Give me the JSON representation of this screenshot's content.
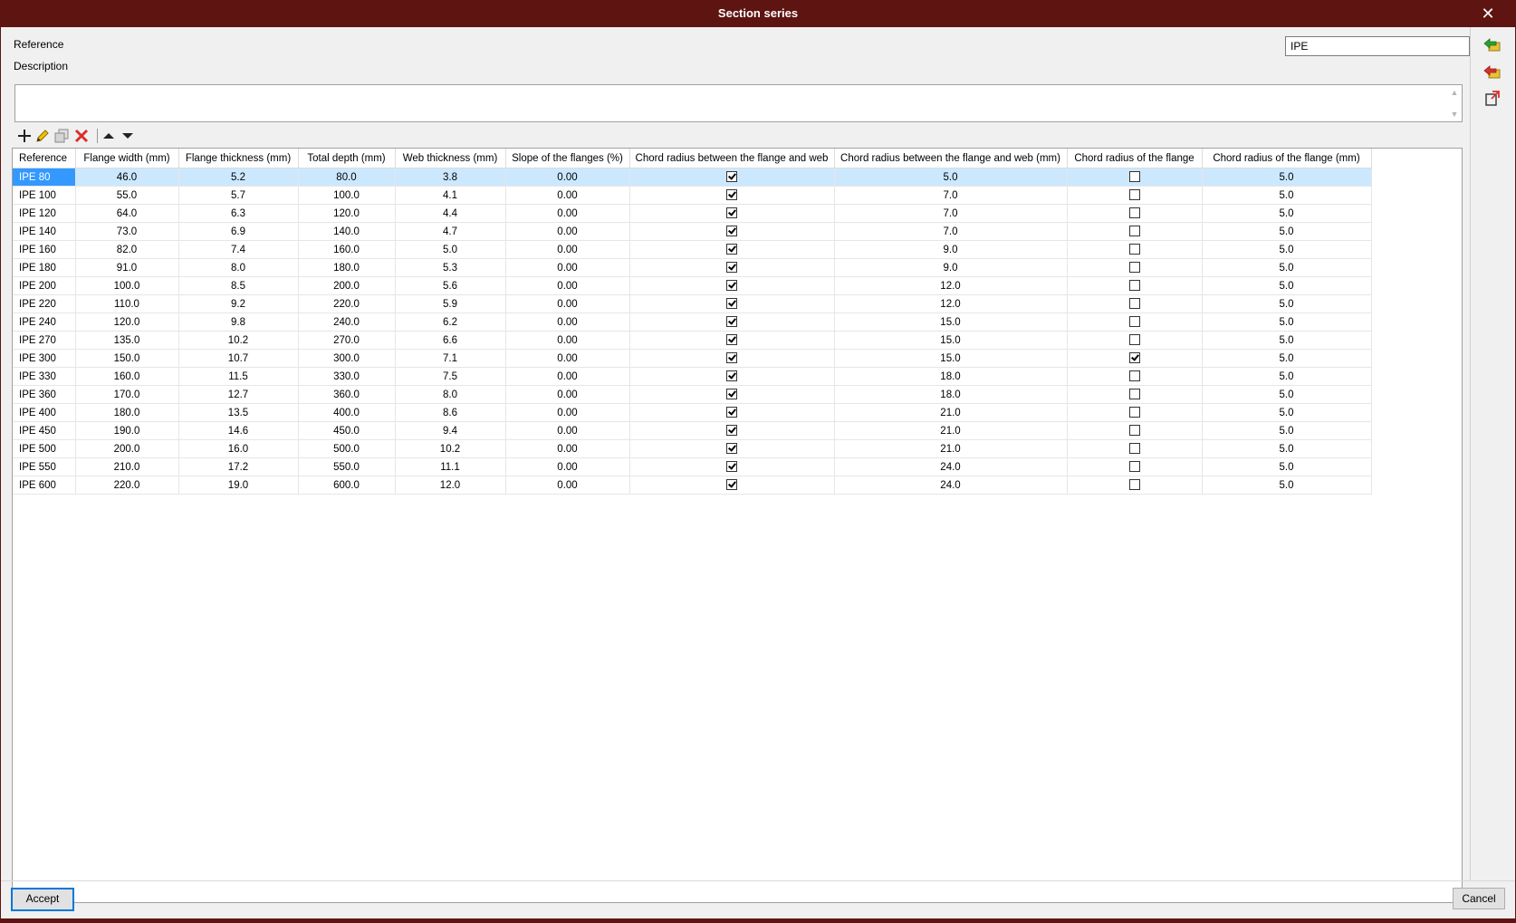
{
  "window": {
    "title": "Section series",
    "close_icon": "close-icon"
  },
  "form": {
    "reference_label": "Reference",
    "reference_value": "IPE",
    "description_label": "Description",
    "description_value": ""
  },
  "toolbar": {
    "icons": [
      "add-icon",
      "edit-pencil-icon",
      "copy-icon",
      "delete-icon",
      "move-up-icon",
      "move-down-icon"
    ]
  },
  "sidebar": {
    "icons": [
      "import-arrow-icon",
      "export-arrow-icon",
      "open-external-icon"
    ]
  },
  "table": {
    "columns": [
      "Reference",
      "Flange width (mm)",
      "Flange thickness (mm)",
      "Total depth (mm)",
      "Web thickness (mm)",
      "Slope of the flanges (%)",
      "Chord radius between the flange and web",
      "Chord radius between the flange and web (mm)",
      "Chord radius of the flange",
      "Chord radius of the flange (mm)"
    ],
    "selected_row": 0,
    "rows": [
      [
        "IPE 80",
        "46.0",
        "5.2",
        "80.0",
        "3.8",
        "0.00",
        true,
        "5.0",
        false,
        "5.0"
      ],
      [
        "IPE 100",
        "55.0",
        "5.7",
        "100.0",
        "4.1",
        "0.00",
        true,
        "7.0",
        false,
        "5.0"
      ],
      [
        "IPE 120",
        "64.0",
        "6.3",
        "120.0",
        "4.4",
        "0.00",
        true,
        "7.0",
        false,
        "5.0"
      ],
      [
        "IPE 140",
        "73.0",
        "6.9",
        "140.0",
        "4.7",
        "0.00",
        true,
        "7.0",
        false,
        "5.0"
      ],
      [
        "IPE 160",
        "82.0",
        "7.4",
        "160.0",
        "5.0",
        "0.00",
        true,
        "9.0",
        false,
        "5.0"
      ],
      [
        "IPE 180",
        "91.0",
        "8.0",
        "180.0",
        "5.3",
        "0.00",
        true,
        "9.0",
        false,
        "5.0"
      ],
      [
        "IPE 200",
        "100.0",
        "8.5",
        "200.0",
        "5.6",
        "0.00",
        true,
        "12.0",
        false,
        "5.0"
      ],
      [
        "IPE 220",
        "110.0",
        "9.2",
        "220.0",
        "5.9",
        "0.00",
        true,
        "12.0",
        false,
        "5.0"
      ],
      [
        "IPE 240",
        "120.0",
        "9.8",
        "240.0",
        "6.2",
        "0.00",
        true,
        "15.0",
        false,
        "5.0"
      ],
      [
        "IPE 270",
        "135.0",
        "10.2",
        "270.0",
        "6.6",
        "0.00",
        true,
        "15.0",
        false,
        "5.0"
      ],
      [
        "IPE 300",
        "150.0",
        "10.7",
        "300.0",
        "7.1",
        "0.00",
        true,
        "15.0",
        true,
        "5.0"
      ],
      [
        "IPE 330",
        "160.0",
        "11.5",
        "330.0",
        "7.5",
        "0.00",
        true,
        "18.0",
        false,
        "5.0"
      ],
      [
        "IPE 360",
        "170.0",
        "12.7",
        "360.0",
        "8.0",
        "0.00",
        true,
        "18.0",
        false,
        "5.0"
      ],
      [
        "IPE 400",
        "180.0",
        "13.5",
        "400.0",
        "8.6",
        "0.00",
        true,
        "21.0",
        false,
        "5.0"
      ],
      [
        "IPE 450",
        "190.0",
        "14.6",
        "450.0",
        "9.4",
        "0.00",
        true,
        "21.0",
        false,
        "5.0"
      ],
      [
        "IPE 500",
        "200.0",
        "16.0",
        "500.0",
        "10.2",
        "0.00",
        true,
        "21.0",
        false,
        "5.0"
      ],
      [
        "IPE 550",
        "210.0",
        "17.2",
        "550.0",
        "11.1",
        "0.00",
        true,
        "24.0",
        false,
        "5.0"
      ],
      [
        "IPE 600",
        "220.0",
        "19.0",
        "600.0",
        "12.0",
        "0.00",
        true,
        "24.0",
        false,
        "5.0"
      ]
    ]
  },
  "buttons": {
    "accept": "Accept",
    "cancel": "Cancel"
  },
  "colors": {
    "titlebar": "#5e1410",
    "selection": "#3399ff",
    "selection_row": "#cce8ff"
  }
}
